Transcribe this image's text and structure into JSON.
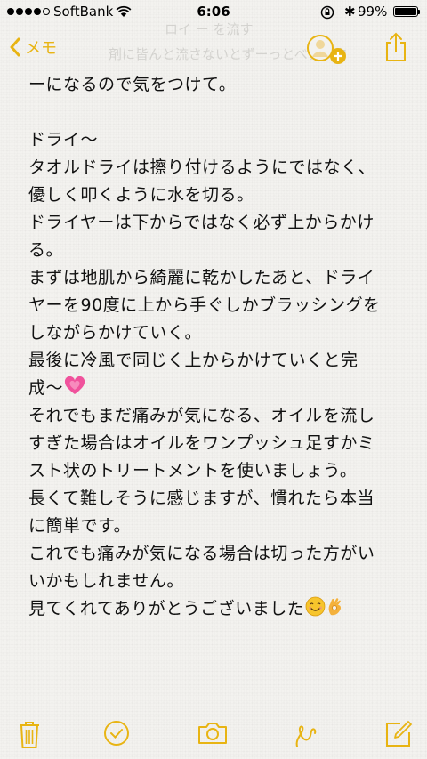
{
  "status_bar": {
    "carrier": "SoftBank",
    "time": "6:06",
    "battery_text": "99%",
    "battery_level": 0.99,
    "signal_bars_filled": 4,
    "signal_bars_total": 5
  },
  "nav": {
    "back_label": "メモ",
    "ghost_lines": [
      "ロイ ー を流す",
      "剤に皆んと流さないとずーっとべタべタ"
    ]
  },
  "note": {
    "lines": [
      "ーになるので気をつけて。",
      "",
      "ドライ〜",
      "タオルドライは擦り付けるようにではなく、",
      "優しく叩くように水を切る。",
      "ドライヤーは下からではなく必ず上からかけ",
      "る。",
      "まずは地肌から綺麗に乾かしたあと、ドライ",
      "ヤーを90度に上から手ぐしかブラッシングを",
      "しながらかけていく。",
      "最後に冷風で同じく上からかけていくと完",
      "成〜",
      "それでもまだ痛みが気になる、オイルを流し",
      "すぎた場合はオイルをワンプッシュ足すかミ",
      "スト状のトリートメントを使いましょう。",
      "長くて難しそうに感じますが、慣れたら本当",
      "に簡単です。",
      "これでも痛みが気になる場合は切った方がい",
      "いかもしれません。",
      "見てくれてありがとうございました"
    ],
    "emoji": {
      "heart_line": "growing-heart-emoji",
      "end_line": [
        "smiling-face-emoji",
        "ok-hand-emoji"
      ]
    }
  },
  "toolbar": {
    "items": [
      "trash-icon",
      "checklist-icon",
      "camera-icon",
      "sketch-icon",
      "compose-icon"
    ]
  },
  "colors": {
    "accent": "#e8b413",
    "background": "#f3f2ef",
    "text": "#111111",
    "heart": "#f0529c"
  }
}
